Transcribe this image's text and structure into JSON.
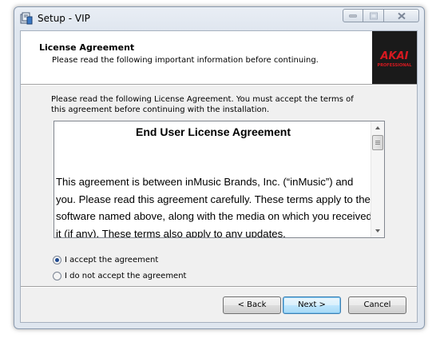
{
  "window": {
    "title": "Setup - VIP"
  },
  "header": {
    "title": "License Agreement",
    "subtitle": "Please read the following important information before continuing.",
    "logo_text": "AKAI",
    "logo_subtext": "PROFESSIONAL"
  },
  "intro_text": "Please read the following License Agreement. You must accept the terms of this agreement before continuing with the installation.",
  "license": {
    "heading": "End User License Agreement",
    "body": "This agreement is between inMusic Brands, Inc. (“inMusic”) and you. Please read this agreement carefully. These terms apply to the software named above, along with the media on which you received it (if any). These terms also apply to any updates,"
  },
  "options": {
    "accept": "I accept the agreement",
    "decline": "I do not accept the agreement",
    "selected": "accept"
  },
  "buttons": {
    "back": "< Back",
    "next": "Next >",
    "cancel": "Cancel"
  },
  "icons": {
    "app": "setup-app-icon",
    "minimize": "minimize-icon",
    "maximize": "maximize-icon",
    "close": "close-icon",
    "scroll_up": "scroll-up-arrow-icon",
    "scroll_down": "scroll-down-arrow-icon"
  },
  "colors": {
    "logo_background": "#1a1a1a",
    "logo_red": "#d71920"
  }
}
